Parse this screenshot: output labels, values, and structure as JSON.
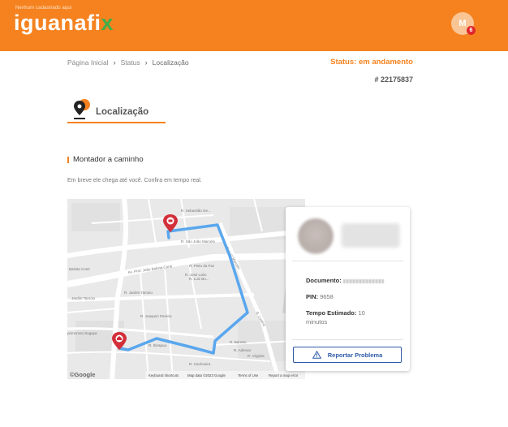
{
  "header": {
    "tagline": "Nenhum cadastrado aqui",
    "logo_main": "iguanafi",
    "logo_x": "x",
    "avatar_initial": "M",
    "notification_count": "6"
  },
  "breadcrumb": {
    "items": [
      "Página Inicial",
      "Status",
      "Localização"
    ]
  },
  "order": {
    "status": "Status: em andamento",
    "number": "# 22175837"
  },
  "section": {
    "title": "Localização",
    "step_label": "Montador a caminho",
    "description": "Em breve ele chega até você. Confira em tempo real."
  },
  "map": {
    "streets": [
      "R. Sebastião Ge...",
      "R. São João Marcelo",
      "Av. Prof. João Batista Conti",
      "Batista Conti",
      "R. José Lobo",
      "R. Luiz Bo...",
      "R. Pinto da Paz",
      "Jardim Tamoio",
      "R. Jardim Tamoio",
      "R. Luiz Marcelo",
      "R. Lorena",
      "R. Ademar",
      "R. Virginia",
      "R. Barreto",
      "R. Joaquim Pereira",
      "primoroso Sugaya",
      "R. Ibirapua",
      "R. Cachoeira"
    ],
    "google": "©Google",
    "attribution": [
      "Keyboard shortcuts",
      "Map data ©2023 Google",
      "Terms of Use",
      "Report a map error"
    ]
  },
  "technician": {
    "document_label": "Documento:",
    "pin_label": "PIN:",
    "pin_value": "9658",
    "eta_label": "Tempo Estimado:",
    "eta_value": "10 minutos",
    "report_button": "Reportar Problema"
  },
  "colors": {
    "brand_orange": "#f5821f",
    "logo_green": "#3fae49",
    "route_blue": "#5aa7ee",
    "pin_red": "#d32f3a",
    "button_blue": "#2f5aa8"
  }
}
